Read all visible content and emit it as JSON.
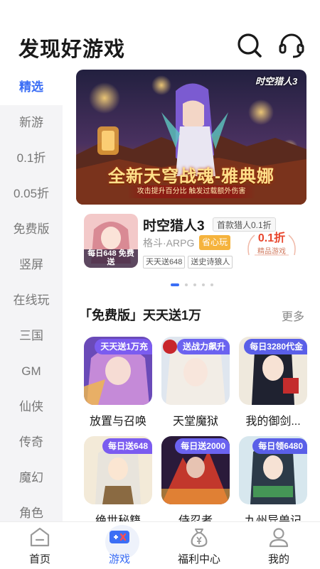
{
  "header": {
    "title": "发现好游戏",
    "search_icon": "search-icon",
    "service_icon": "headset-icon"
  },
  "sidebar": {
    "items": [
      {
        "label": "精选",
        "active": true
      },
      {
        "label": "新游"
      },
      {
        "label": "0.1折"
      },
      {
        "label": "0.05折"
      },
      {
        "label": "免费版"
      },
      {
        "label": "竖屏"
      },
      {
        "label": "在线玩"
      },
      {
        "label": "三国"
      },
      {
        "label": "GM"
      },
      {
        "label": "仙侠"
      },
      {
        "label": "传奇"
      },
      {
        "label": "魔幻"
      },
      {
        "label": "角色"
      }
    ]
  },
  "banner": {
    "logo": "时空猎人3",
    "title": "全新天穹战魂-雅典娜",
    "subtitle": "攻击提升百分比 触发过载额外伤害"
  },
  "featured": {
    "name": "时空猎人3",
    "pill": "首款猎人0.1折",
    "genre": "格斗·ARPG",
    "online_label": "省心玩",
    "tags": [
      "天天送648",
      "送史诗狼人"
    ],
    "discount": "0.1折",
    "discount_label": "精品游戏",
    "cover_text": "每日648 免费送"
  },
  "carousel": {
    "count": 5,
    "active_index": 0
  },
  "section": {
    "title": "「免费版」天天送1万",
    "more": "更多"
  },
  "games": [
    {
      "name": "放置与召唤",
      "badge": "天天送1万充",
      "badge_color": "#7b5cf0"
    },
    {
      "name": "天堂魔狱",
      "badge": "送战力飙升",
      "badge_color": "#6b63f0"
    },
    {
      "name": "我的御剑...",
      "badge": "每日3280代金",
      "badge_color": "#5a5fe8"
    },
    {
      "name": "绝世秘籍",
      "badge": "每日送648",
      "badge_color": "#7b5cf0"
    },
    {
      "name": "侍忍者",
      "badge": "每日送2000",
      "badge_color": "#6b63f0"
    },
    {
      "name": "九州异兽记",
      "badge": "每日领6480",
      "badge_color": "#5a5fe8"
    }
  ],
  "bottom_nav": [
    {
      "label": "首页",
      "icon": "home-icon"
    },
    {
      "label": "游戏",
      "icon": "gamepad-icon",
      "active": true
    },
    {
      "label": "福利中心",
      "icon": "money-bag-icon"
    },
    {
      "label": "我的",
      "icon": "profile-icon"
    }
  ],
  "colors": {
    "accent": "#3b6ef5",
    "sidebar_bg": "#f4f4f6",
    "online_badge": "#f5b33d",
    "discount": "#e8462d"
  }
}
